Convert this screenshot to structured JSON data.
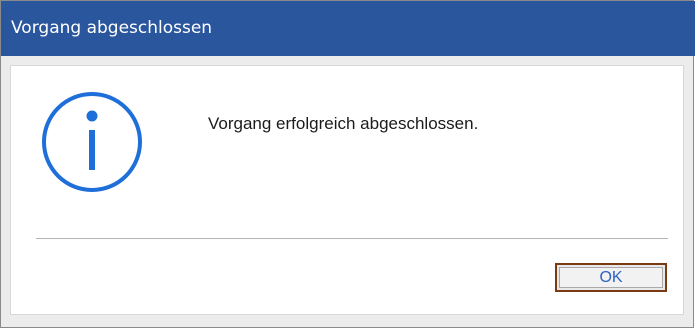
{
  "window": {
    "title": "Vorgang abgeschlossen"
  },
  "dialog": {
    "icon": "info-icon",
    "message": "Vorgang erfolgreich abgeschlossen.",
    "ok_label": "OK"
  },
  "colors": {
    "titlebar": "#2a569d",
    "title_text": "#ffffff",
    "icon": "#1e6fd9",
    "ok_border": "#7a3b12",
    "ok_text": "#2a63c0"
  }
}
